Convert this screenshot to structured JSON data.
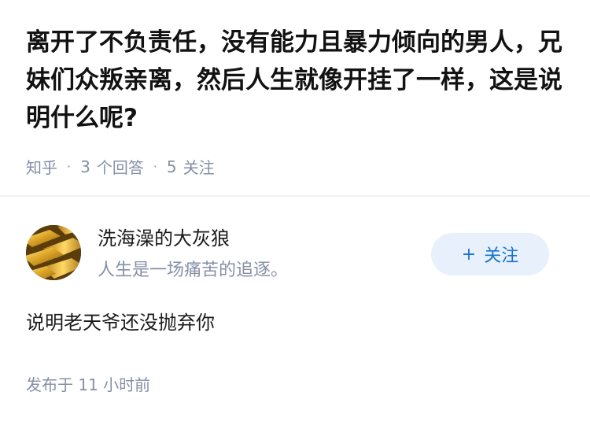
{
  "question": {
    "title": "离开了不负责任，没有能力且暴力倾向的男人，兄妹们众叛亲离，然后人生就像开挂了一样，这是说明什么呢?",
    "source": "知乎",
    "separator": "·",
    "answers_count": "3",
    "answers_label": "个回答",
    "followers_count": "5",
    "followers_label": "关注"
  },
  "answer": {
    "author_name": "洗海澡的大灰狼",
    "author_bio": "人生是一场痛苦的追逐。",
    "follow_button": {
      "icon": "plus-icon",
      "plus": "+",
      "label": "关注"
    },
    "content": "说明老天爷还没抛弃你",
    "published_label": "发布于",
    "published_time": "11 小时前"
  },
  "colors": {
    "accent": "#1772d0",
    "button_bg": "#e8f1fb",
    "muted": "#8590a6"
  }
}
